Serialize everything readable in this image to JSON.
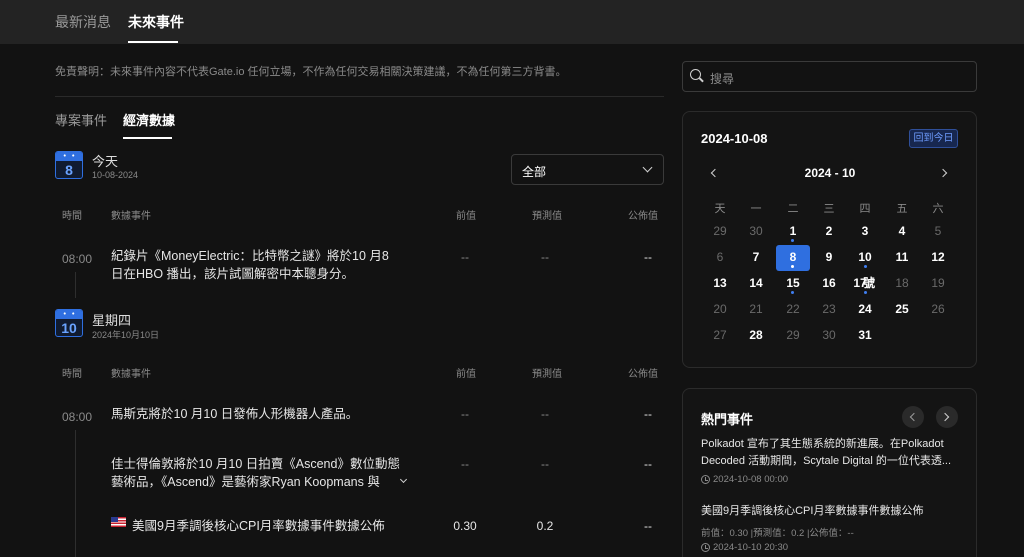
{
  "top_tabs": {
    "news": "最新消息",
    "upcoming": "未來事件"
  },
  "disclaimer": "免責聲明：未來事件內容不代表Gate.io 任何立場，不作為任何交易相關決策建議，不為任何第三方背書。",
  "sub_tabs": {
    "project": "專案事件",
    "economic": "經濟數據"
  },
  "filter": {
    "value": "全部"
  },
  "table_headers": {
    "time": "時間",
    "event": "數據事件",
    "previous": "前值",
    "forecast": "預測值",
    "actual": "公佈值"
  },
  "days": [
    {
      "icon_number": "8",
      "title": "今天",
      "date": "10-08-2024",
      "rows": [
        {
          "time": "08:00",
          "event_line1": "紀錄片《MoneyElectric：比特幣之謎》將於10 月8",
          "event_line2": "日在HBO 播出，該片試圖解密中本聰身分。",
          "previous": "--",
          "forecast": "--",
          "actual": "--"
        }
      ]
    },
    {
      "icon_number": "10",
      "title": "星期四",
      "date": "2024年10月10日",
      "rows": [
        {
          "time": "08:00",
          "event_line1": "馬斯克將於10 月10 日發佈人形機器人產品。",
          "previous": "--",
          "forecast": "--",
          "actual": "--"
        },
        {
          "event_line1": "佳士得倫敦將於10 月10 日拍賣《Ascend》數位動態",
          "event_line2": "藝術品，《Ascend》是藝術家Ryan Koopmans 與",
          "previous": "--",
          "forecast": "--",
          "actual": "--"
        },
        {
          "event_line1": "美國9月季調後核心CPI月率數據事件數據公佈",
          "previous": "0.30",
          "forecast": "0.2",
          "actual": "--"
        }
      ]
    }
  ],
  "search": {
    "placeholder": "搜尋"
  },
  "calendar": {
    "selected_date": "2024-10-08",
    "today_button": "回到今日",
    "month_label": "2024 - 10",
    "weekdays": [
      "天",
      "一",
      "二",
      "三",
      "四",
      "五",
      "六"
    ],
    "weeks": [
      [
        "29",
        "30",
        "1",
        "2",
        "3",
        "4",
        "5"
      ],
      [
        "6",
        "7",
        "8",
        "9",
        "10",
        "11",
        "12"
      ],
      [
        "13",
        "14",
        "15",
        "16",
        "17",
        "18",
        "19"
      ],
      [
        "20",
        "21",
        "22",
        "23",
        "24",
        "25",
        "26"
      ],
      [
        "27",
        "28",
        "29",
        "30",
        "31"
      ]
    ],
    "overlay_label": "號"
  },
  "hot_events": {
    "title": "熱門事件",
    "items": [
      {
        "text_line1": "Polkadot 宣布了其生態系統的新進展。在Polkadot",
        "text_line2": "Decoded 活動期間，Scytale Digital 的一位代表透...",
        "time": "2024-10-08 00:00"
      },
      {
        "text_line1": "美國9月季調後核心CPI月率數據事件數據公佈",
        "meta": "前值：0.30 |預測值：0.2 |公佈值：--",
        "time": "2024-10-10 20:30"
      }
    ]
  },
  "colors": {
    "accent": "#2f6fe0",
    "background": "#121212",
    "topbar": "#232323"
  }
}
